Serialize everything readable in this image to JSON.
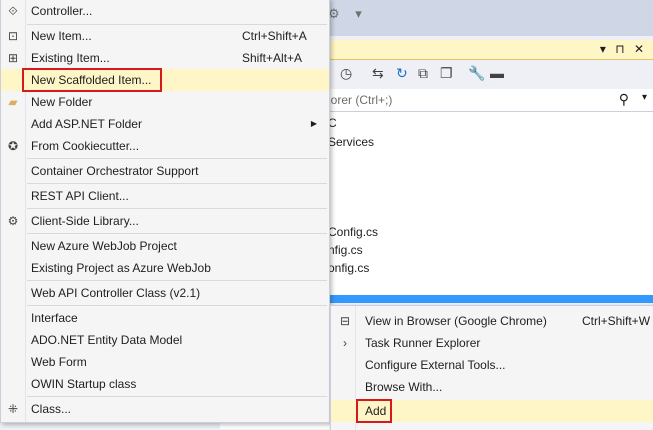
{
  "background": {
    "search_placeholder": "lorer (Ctrl+;)",
    "tree_items": [
      "C",
      "Services",
      "Config.cs",
      "nfig.cs",
      "onfig.cs"
    ]
  },
  "main_menu": {
    "items": [
      {
        "label": "Controller...",
        "shortcut": "",
        "icon": "controller-icon"
      },
      {
        "label": "New Item...",
        "shortcut": "Ctrl+Shift+A",
        "icon": "new-item-icon"
      },
      {
        "label": "Existing Item...",
        "shortcut": "Shift+Alt+A",
        "icon": "existing-item-icon"
      },
      {
        "label": "New Scaffolded Item...",
        "shortcut": "",
        "icon": ""
      },
      {
        "label": "New Folder",
        "shortcut": "",
        "icon": "new-folder-icon"
      },
      {
        "label": "Add ASP.NET Folder",
        "shortcut": "",
        "icon": ""
      },
      {
        "label": "From Cookiecutter...",
        "shortcut": "",
        "icon": "cookiecutter-icon"
      },
      {
        "label": "Container Orchestrator Support",
        "shortcut": "",
        "icon": ""
      },
      {
        "label": "REST API Client...",
        "shortcut": "",
        "icon": ""
      },
      {
        "label": "Client-Side Library...",
        "shortcut": "",
        "icon": "client-library-icon"
      },
      {
        "label": "New Azure WebJob Project",
        "shortcut": "",
        "icon": ""
      },
      {
        "label": "Existing Project as Azure WebJob",
        "shortcut": "",
        "icon": ""
      },
      {
        "label": "Web API Controller Class (v2.1)",
        "shortcut": "",
        "icon": ""
      },
      {
        "label": "Interface",
        "shortcut": "",
        "icon": ""
      },
      {
        "label": "ADO.NET Entity Data Model",
        "shortcut": "",
        "icon": ""
      },
      {
        "label": "Web Form",
        "shortcut": "",
        "icon": ""
      },
      {
        "label": "OWIN Startup class",
        "shortcut": "",
        "icon": ""
      },
      {
        "label": "Class...",
        "shortcut": "",
        "icon": "class-icon"
      }
    ]
  },
  "sub_menu": {
    "items": [
      {
        "label": "View in Browser (Google Chrome)",
        "shortcut": "Ctrl+Shift+W",
        "icon": "view-browser-icon"
      },
      {
        "label": "Task Runner Explorer",
        "shortcut": "",
        "icon": "chevron-right-icon"
      },
      {
        "label": "Configure External Tools...",
        "shortcut": "",
        "icon": ""
      },
      {
        "label": "Browse With...",
        "shortcut": "",
        "icon": ""
      },
      {
        "label": "Add",
        "shortcut": "",
        "icon": ""
      }
    ]
  },
  "colors": {
    "highlight": "#fff6c8",
    "annotation_red": "#d6191e",
    "selection": "#3399ff"
  }
}
